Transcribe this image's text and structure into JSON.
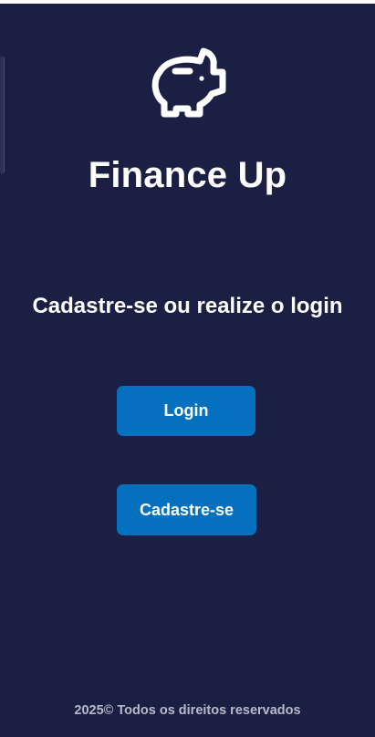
{
  "app": {
    "title": "Finance Up",
    "logo_icon": "piggy-bank-icon"
  },
  "main": {
    "subtitle": "Cadastre-se ou realize o login",
    "login_label": "Login",
    "register_label": "Cadastre-se"
  },
  "footer": {
    "text": "2025© Todos os direitos reservados"
  },
  "colors": {
    "background": "#1b1f44",
    "button": "#0570bd",
    "text": "#ffffff",
    "footer_text": "#b8bacb"
  }
}
